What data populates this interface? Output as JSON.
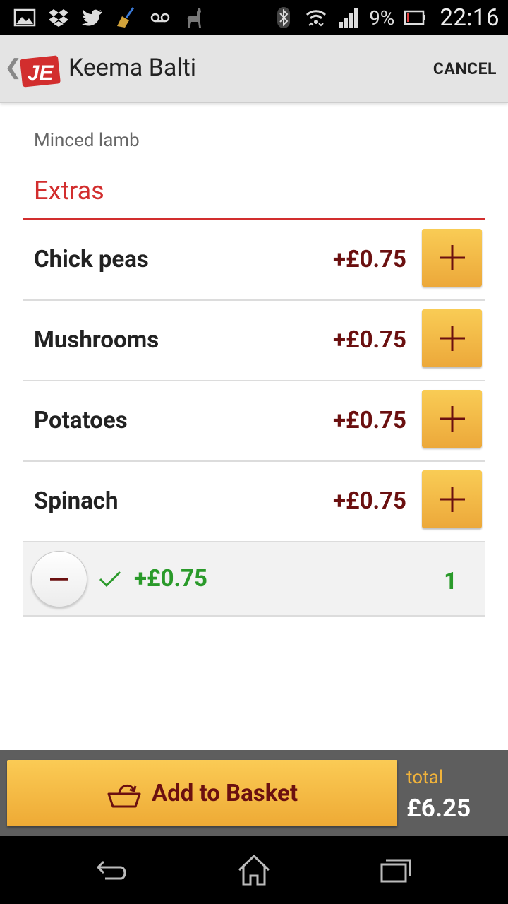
{
  "status_bar": {
    "battery_percent": "9%",
    "time": "22:16",
    "left_icons": [
      "gallery-icon",
      "dropbox-icon",
      "twitter-icon",
      "cleaner-broom-icon",
      "voicemail-icon",
      "llama-icon"
    ],
    "right_icons": [
      "bluetooth-icon",
      "wifi-icon",
      "signal-icon",
      "battery-icon"
    ]
  },
  "action_bar": {
    "logo_text": "JE",
    "title": "Keema Balti",
    "cancel_label": "CANCEL"
  },
  "item": {
    "subtitle": "Minced lamb"
  },
  "extras": {
    "title": "Extras",
    "options": [
      {
        "name": "Chick peas",
        "price": "+£0.75"
      },
      {
        "name": "Mushrooms",
        "price": "+£0.75"
      },
      {
        "name": "Potatoes",
        "price": "+£0.75"
      },
      {
        "name": "Spinach",
        "price": "+£0.75"
      }
    ],
    "selected": {
      "price": "+£0.75",
      "quantity": "1"
    }
  },
  "basket": {
    "button_label": "Add to Basket",
    "total_label": "total",
    "total_value": "£6.25"
  },
  "colors": {
    "accent_red": "#d22e2e",
    "price_maroon": "#6b1010",
    "button_yellow": "#f5bb45",
    "selected_green": "#2a9a2a"
  }
}
